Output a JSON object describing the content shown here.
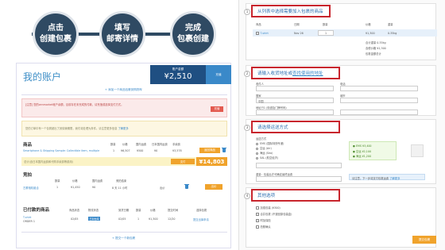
{
  "steps": [
    {
      "line1": "点击",
      "line2": "创建包裹"
    },
    {
      "line1": "填写",
      "line2": "邮寄详情"
    },
    {
      "line1": "完成",
      "line2": "包裹创建"
    }
  ],
  "account": {
    "title": "我的账户",
    "points_label": "账户金额",
    "points_value": "¥2,510",
    "points_button": "充值",
    "add_new": "+ 添加一个商品包裹到购物车",
    "alert_red": "[注意] 您的zenmarket帐户余额，目前存在未完成的付款，请充值或选择支付方式。",
    "alert_red_button": "充值",
    "alert_yellow": "您的订单中有一个包裹超出了其保管期限，我们将处理为弃件。请注意更多信息",
    "alert_yellow_link": "了解更多",
    "goods": {
      "heading": "商品",
      "headers": [
        "数量",
        "价格",
        "国内运费",
        "日本国内运费",
        "手续费"
      ],
      "item_name": "Smartphone & Shipping Sample: Collectible item, multiple",
      "row": [
        "1",
        "¥6,507",
        "¥500",
        "¥0",
        "¥3,578"
      ],
      "row_tag": "返回商品",
      "total_text": "总计(含日本国内运费和代购手续费等费用)",
      "total_tag": "支付",
      "total_value": "¥14,803"
    },
    "auction": {
      "heading": "竞拍",
      "headers": [
        "数量",
        "价格",
        "国内运费",
        "竞拍结束"
      ],
      "item_name": "古董相机组合",
      "row": [
        "1",
        "¥1,450",
        "¥0",
        "8 天 11 小时",
        "出价"
      ],
      "button": "出价"
    },
    "purchased": {
      "heading": "已付款的商品",
      "headers": [
        "商品状态",
        "物流状态",
        "到货日期",
        "数量",
        "价格",
        "提交时间",
        "选择包裹"
      ],
      "item_name": "T-shirt",
      "item_sub": "ORDER 1",
      "row": [
        "02/05",
        "已到达仓库",
        "02/05",
        "1",
        "¥1,300",
        "12/20"
      ],
      "chip": "已到仓库",
      "link": "提交出库申请"
    },
    "add_bottom": "+ 提交一个新包裹"
  },
  "right": {
    "s1": {
      "num": "1",
      "title": "从列表中选择需要加入包裹的商品",
      "headers": [
        "商品",
        "日期",
        "数量",
        "价格",
        "重量"
      ],
      "row1": [
        "T-shirt",
        "Nov 26",
        "1",
        "¥1,300",
        "0.35kg"
      ],
      "sum1": "合计重量 0.35kg",
      "sum2": "含税价格 ¥1,300",
      "sum3": "包裹金额总计"
    },
    "s2": {
      "num": "2",
      "title": "请输入收货地址或",
      "title_link": "查找使用的地址",
      "labels": [
        "收件人",
        "电话",
        "地址",
        "国家",
        "城市",
        "邮编",
        "地址行1 (街道及门牌号码)"
      ],
      "select_placeholder": "中国"
    },
    "s3": {
      "num": "3",
      "title": "请选择运送方式",
      "methods": [
        "EMS (国际特快专递)",
        "空运 (Air)",
        "海运 (Sea)",
        "SAL (航空经济)"
      ],
      "text1": "运送方式",
      "text2": "重量：包装后才可确定最终运费",
      "green1": "● EMS ¥3,400",
      "green2": "● 空运 ¥2,100",
      "green3": "● 海运 ¥1,200",
      "note": "请注意，下一步将支付包裹运费",
      "note_link": "了解更多"
    },
    "s4": {
      "num": "4",
      "title": "其他选项",
      "options": [
        "加强包装 (¥300)",
        "合并包裹 (不退回原包装盒)",
        "附加保险",
        "拍照确认"
      ],
      "submit": "提交包裹"
    }
  }
}
